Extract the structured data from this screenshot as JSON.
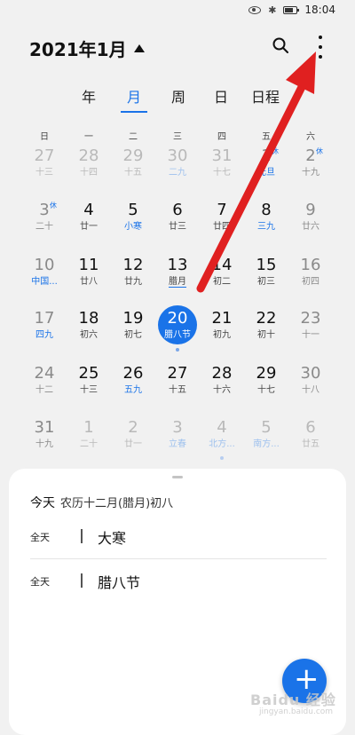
{
  "status_bar": {
    "time": "18:04"
  },
  "header": {
    "month_title": "2021年1月"
  },
  "view_tabs": [
    {
      "label": "年"
    },
    {
      "label": "月"
    },
    {
      "label": "周"
    },
    {
      "label": "日"
    },
    {
      "label": "日程"
    }
  ],
  "weekdays": [
    "日",
    "一",
    "二",
    "三",
    "四",
    "五",
    "六"
  ],
  "calendar": {
    "weeks": [
      [
        {
          "day": "27",
          "sub": "十三",
          "out": true
        },
        {
          "day": "28",
          "sub": "十四",
          "out": true
        },
        {
          "day": "29",
          "sub": "十五",
          "out": true
        },
        {
          "day": "30",
          "sub": "二九",
          "out": true,
          "sub_blue": true
        },
        {
          "day": "31",
          "sub": "十七",
          "out": true
        },
        {
          "day": "1",
          "sub": "元旦",
          "sub_blue": true,
          "badge": "休",
          "weekend": true
        },
        {
          "day": "2",
          "sub": "十九",
          "badge": "休",
          "weekend": true
        }
      ],
      [
        {
          "day": "3",
          "sub": "二十",
          "badge": "休",
          "weekend": true
        },
        {
          "day": "4",
          "sub": "廿一"
        },
        {
          "day": "5",
          "sub": "小寒",
          "sub_blue": true
        },
        {
          "day": "6",
          "sub": "廿三"
        },
        {
          "day": "7",
          "sub": "廿四"
        },
        {
          "day": "8",
          "sub": "三九",
          "sub_blue": true
        },
        {
          "day": "9",
          "sub": "廿六",
          "weekend": true
        }
      ],
      [
        {
          "day": "10",
          "sub": "中国...",
          "sub_blue": true,
          "weekend": true
        },
        {
          "day": "11",
          "sub": "廿八"
        },
        {
          "day": "12",
          "sub": "廿九"
        },
        {
          "day": "13",
          "sub": "腊月",
          "underline": true
        },
        {
          "day": "14",
          "sub": "初二"
        },
        {
          "day": "15",
          "sub": "初三"
        },
        {
          "day": "16",
          "sub": "初四",
          "weekend": true
        }
      ],
      [
        {
          "day": "17",
          "sub": "四九",
          "sub_blue": true,
          "weekend": true
        },
        {
          "day": "18",
          "sub": "初六"
        },
        {
          "day": "19",
          "sub": "初七"
        },
        {
          "day": "20",
          "sub": "腊八节",
          "today": true,
          "dot": true
        },
        {
          "day": "21",
          "sub": "初九"
        },
        {
          "day": "22",
          "sub": "初十"
        },
        {
          "day": "23",
          "sub": "十一",
          "weekend": true
        }
      ],
      [
        {
          "day": "24",
          "sub": "十二",
          "weekend": true
        },
        {
          "day": "25",
          "sub": "十三"
        },
        {
          "day": "26",
          "sub": "五九",
          "sub_blue": true
        },
        {
          "day": "27",
          "sub": "十五"
        },
        {
          "day": "28",
          "sub": "十六"
        },
        {
          "day": "29",
          "sub": "十七"
        },
        {
          "day": "30",
          "sub": "十八",
          "weekend": true
        }
      ],
      [
        {
          "day": "31",
          "sub": "十九",
          "weekend": true
        },
        {
          "day": "1",
          "sub": "二十",
          "out": true
        },
        {
          "day": "2",
          "sub": "廿一",
          "out": true
        },
        {
          "day": "3",
          "sub": "立春",
          "out": true,
          "sub_blue": true
        },
        {
          "day": "4",
          "sub": "北方...",
          "out": true,
          "sub_blue": true,
          "dot": true
        },
        {
          "day": "5",
          "sub": "南方...",
          "out": true,
          "sub_blue": true
        },
        {
          "day": "6",
          "sub": "廿五",
          "out": true
        }
      ]
    ]
  },
  "today_panel": {
    "today_label": "今天",
    "lunar_date": "农历十二月(腊月)初八",
    "events": [
      {
        "allday_label": "全天",
        "title": "大寒"
      },
      {
        "allday_label": "全天",
        "title": "腊八节"
      }
    ]
  },
  "fab": {
    "label": "+"
  },
  "watermark": {
    "text": "Baidu 经验",
    "sub": "jingyan.baidu.com"
  },
  "colors": {
    "accent": "#1a73e8",
    "annotation_arrow": "#e02020"
  }
}
